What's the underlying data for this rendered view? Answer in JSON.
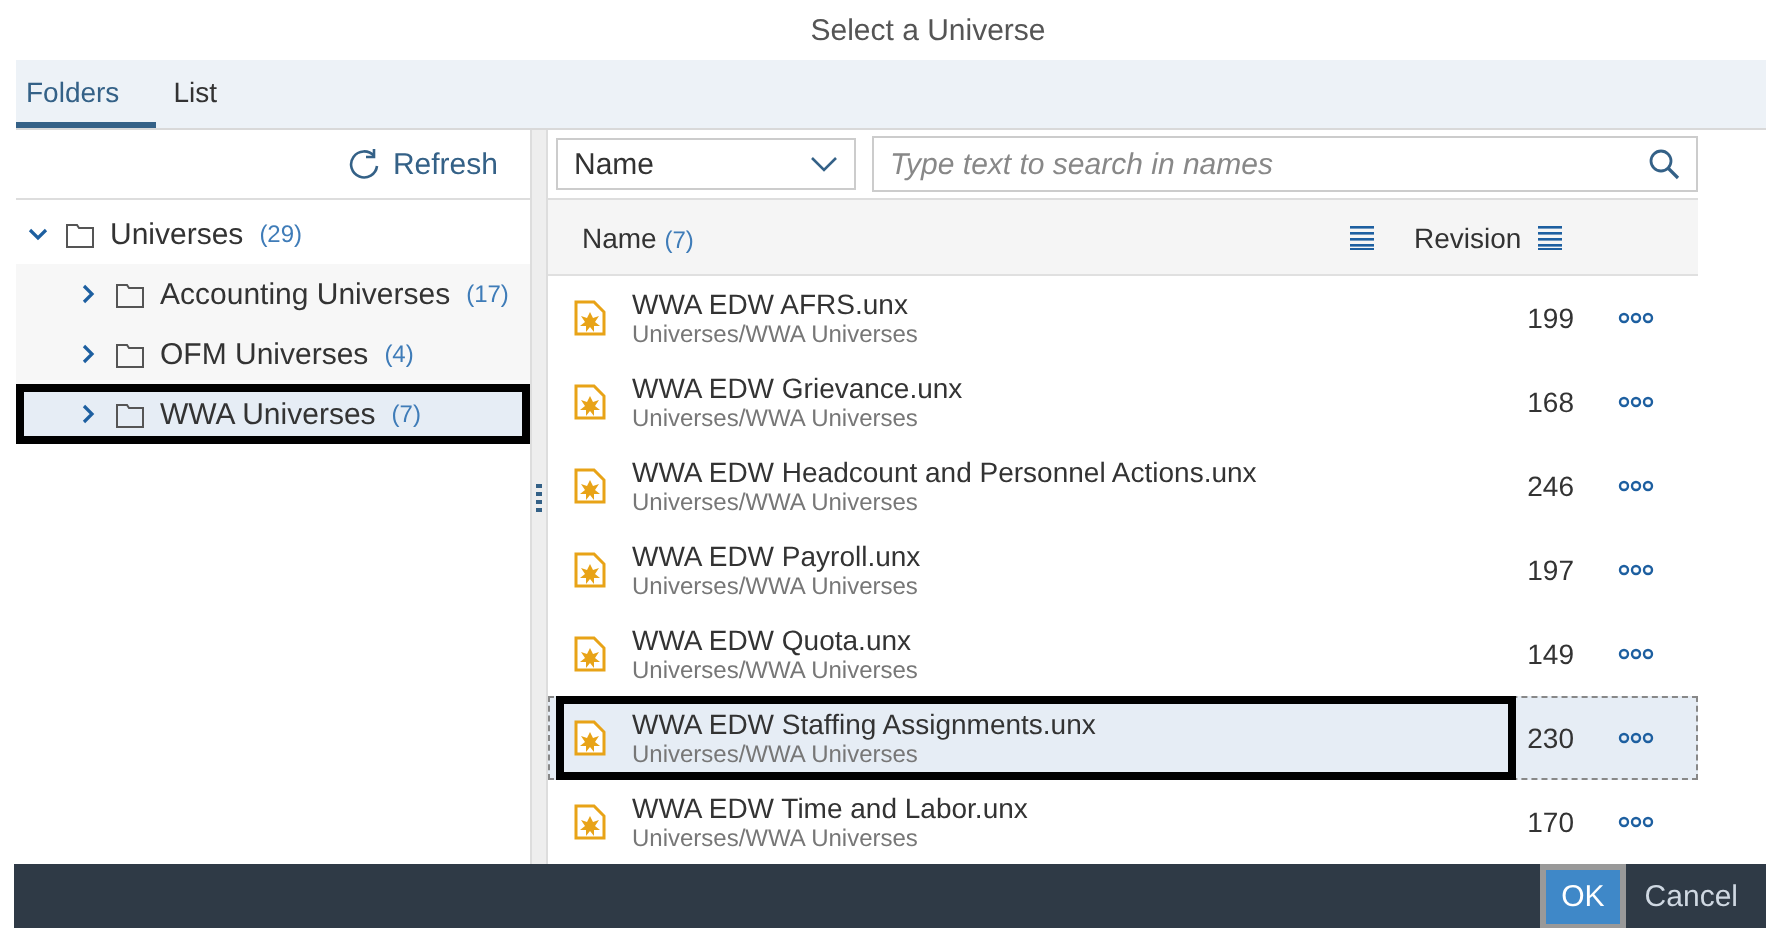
{
  "dialog": {
    "title": "Select a Universe"
  },
  "tabs": [
    {
      "label": "Folders",
      "selected": true
    },
    {
      "label": "List",
      "selected": false
    }
  ],
  "refresh_button": "Refresh",
  "tree": [
    {
      "label": "Universes",
      "count": "(29)",
      "expanded": true,
      "selected": false,
      "outlined": false,
      "children": [
        {
          "label": "Accounting Universes",
          "count": "(17)",
          "expanded": false,
          "selected": false,
          "outlined": false
        },
        {
          "label": "OFM Universes",
          "count": "(4)",
          "expanded": false,
          "selected": false,
          "outlined": false
        },
        {
          "label": "WWA Universes",
          "count": "(7)",
          "expanded": false,
          "selected": true,
          "outlined": true
        }
      ]
    }
  ],
  "filter": {
    "dropdown": "Name",
    "placeholder": "Type text to search in names"
  },
  "table": {
    "columns": [
      {
        "label": "Name",
        "count": "(7)"
      },
      {
        "label": "Revision"
      }
    ],
    "rows": [
      {
        "name": "WWA EDW AFRS.unx",
        "path": "Universes/WWA Universes",
        "revision": "199",
        "selected": false,
        "outlined": false
      },
      {
        "name": "WWA EDW Grievance.unx",
        "path": "Universes/WWA Universes",
        "revision": "168",
        "selected": false,
        "outlined": false
      },
      {
        "name": "WWA EDW Headcount and Personnel Actions.unx",
        "path": "Universes/WWA Universes",
        "revision": "246",
        "selected": false,
        "outlined": false
      },
      {
        "name": "WWA EDW Payroll.unx",
        "path": "Universes/WWA Universes",
        "revision": "197",
        "selected": false,
        "outlined": false
      },
      {
        "name": "WWA EDW Quota.unx",
        "path": "Universes/WWA Universes",
        "revision": "149",
        "selected": false,
        "outlined": false
      },
      {
        "name": "WWA EDW Staffing Assignments.unx",
        "path": "Universes/WWA Universes",
        "revision": "230",
        "selected": true,
        "outlined": true
      },
      {
        "name": "WWA EDW Time and Labor.unx",
        "path": "Universes/WWA Universes",
        "revision": "170",
        "selected": false,
        "outlined": false
      }
    ]
  },
  "footer": {
    "buttons": [
      {
        "label": "OK",
        "kind": "primary"
      },
      {
        "label": "Cancel",
        "kind": "plain"
      }
    ]
  }
}
